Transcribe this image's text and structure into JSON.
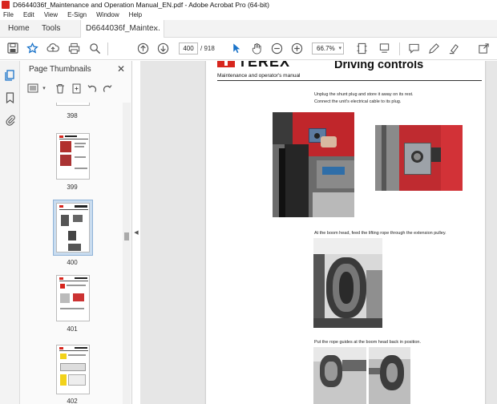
{
  "window": {
    "title": "D6644036f_Maintenance and Operation Manual_EN.pdf - Adobe Acrobat Pro (64-bit)"
  },
  "menu": [
    "File",
    "Edit",
    "View",
    "E-Sign",
    "Window",
    "Help"
  ],
  "tabs": {
    "home": "Home",
    "tools": "Tools",
    "document": "D6644036f_Mainte...",
    "close": "×"
  },
  "toolbar": {
    "current_page": "400",
    "page_total": "/ 918",
    "zoom": "66.7%",
    "icons": [
      "save-icon",
      "bookmark-star-icon",
      "cloud-upload-icon",
      "print-icon",
      "search-zoom-icon",
      "page-up-icon",
      "page-down-icon",
      "select-cursor-icon",
      "hand-icon",
      "zoom-out-icon",
      "zoom-in-icon",
      "fit-page-icon",
      "scroll-mode-icon",
      "comment-icon",
      "draw-icon",
      "highlight-icon",
      "share-icon"
    ]
  },
  "sidebar": {
    "panel_title": "Page Thumbnails",
    "thumbnails": [
      {
        "label": "398"
      },
      {
        "label": "399"
      },
      {
        "label": "400",
        "selected": true
      },
      {
        "label": "401"
      },
      {
        "label": "402"
      }
    ]
  },
  "document_page": {
    "logo_text": "TEREX",
    "heading": "Driving controls",
    "subtitle": "Maintenance and operator's manual",
    "step1_line1": "Unplug the shunt plug and store it away on its rest.",
    "step1_line2": "Connect the unit's electrical cable to its plug.",
    "step2": "At the boom head, feed the lifting rope through the extension pulley.",
    "step3": "Put the rope guides at the boom head back in position."
  },
  "colors": {
    "brand_red": "#d7261e",
    "selection_blue": "#c9dcef",
    "accent_blue": "#1a73c9"
  }
}
